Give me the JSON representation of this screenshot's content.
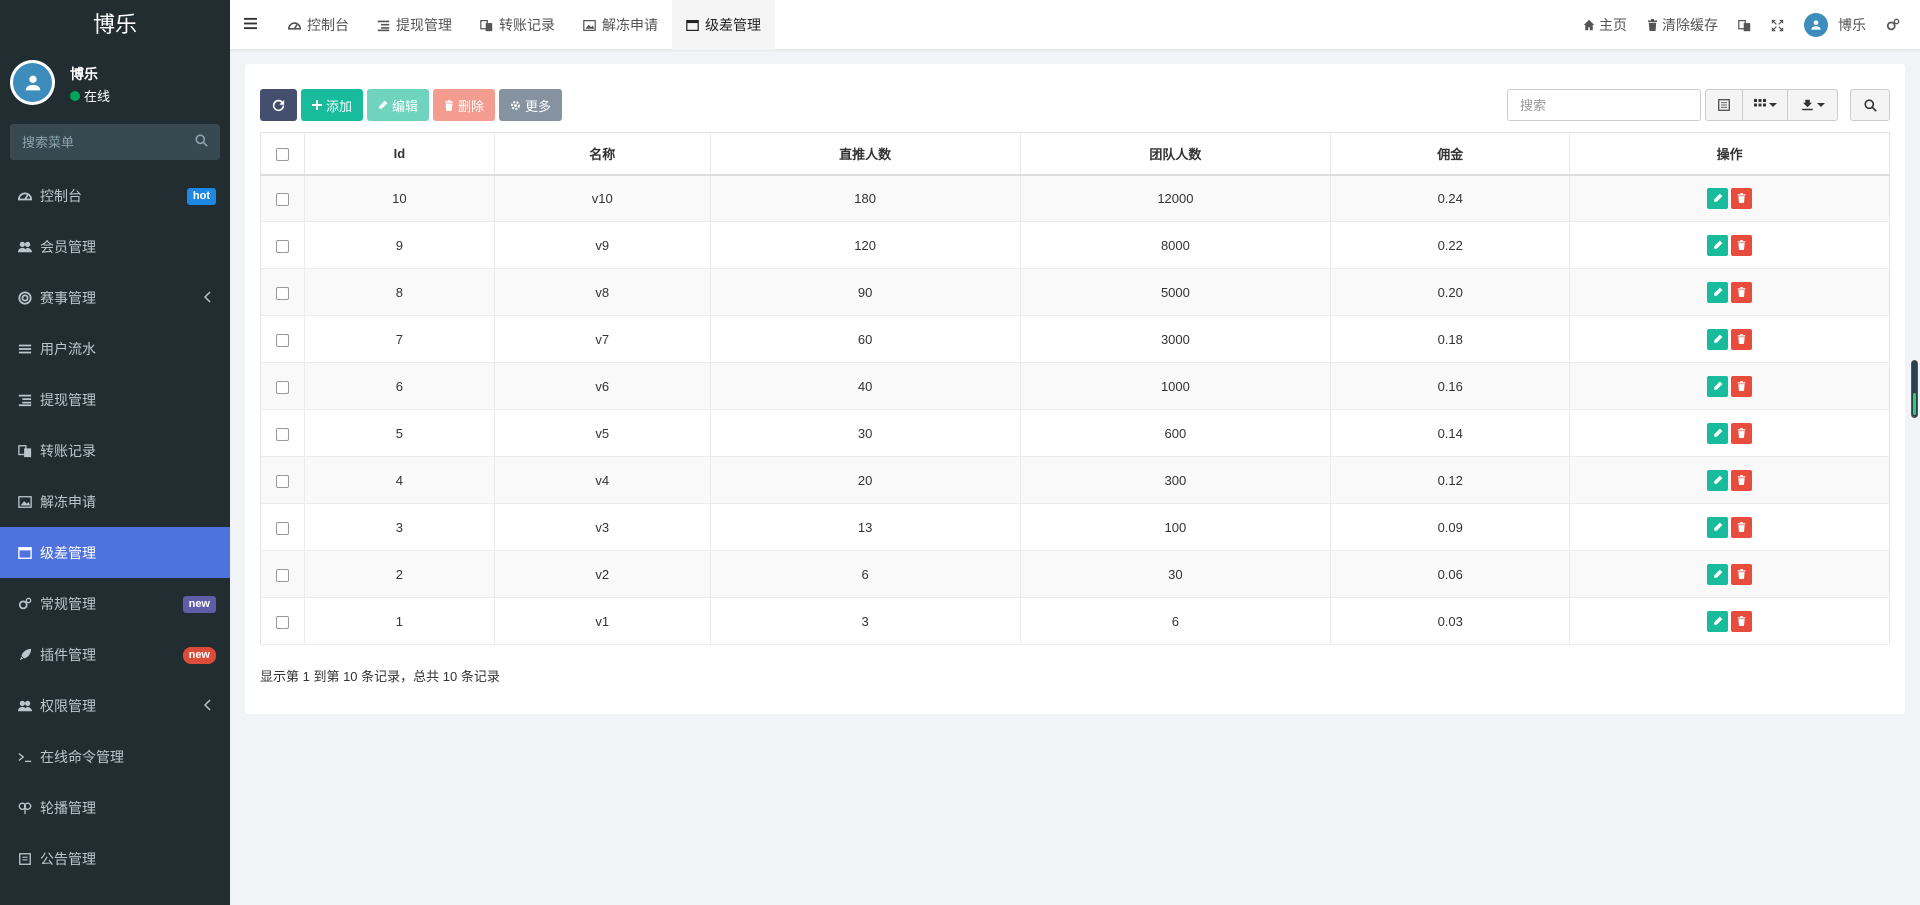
{
  "sidebar": {
    "logo": "博乐",
    "user": {
      "name": "博乐",
      "status": "在线"
    },
    "search_placeholder": "搜索菜单",
    "items": [
      {
        "label": "控制台",
        "badge": "hot"
      },
      {
        "label": "会员管理"
      },
      {
        "label": "赛事管理"
      },
      {
        "label": "用户流水"
      },
      {
        "label": "提现管理"
      },
      {
        "label": "转账记录"
      },
      {
        "label": "解冻申请"
      },
      {
        "label": "级差管理"
      },
      {
        "label": "常规管理",
        "badge": "new"
      },
      {
        "label": "插件管理",
        "badge": "new"
      },
      {
        "label": "权限管理"
      },
      {
        "label": "在线命令管理"
      },
      {
        "label": "轮播管理"
      },
      {
        "label": "公告管理"
      }
    ]
  },
  "navbar": {
    "tabs": [
      "控制台",
      "提现管理",
      "转账记录",
      "解冻申请",
      "级差管理"
    ],
    "home": "主页",
    "clear_cache": "清除缓存",
    "username": "博乐"
  },
  "toolbar": {
    "add": "添加",
    "edit": "编辑",
    "delete": "删除",
    "more": "更多",
    "search_placeholder": "搜索"
  },
  "table": {
    "headers": [
      "Id",
      "名称",
      "直推人数",
      "团队人数",
      "佣金",
      "操作"
    ],
    "rows": [
      [
        "10",
        "v10",
        "180",
        "12000",
        "0.24"
      ],
      [
        "9",
        "v9",
        "120",
        "8000",
        "0.22"
      ],
      [
        "8",
        "v8",
        "90",
        "5000",
        "0.20"
      ],
      [
        "7",
        "v7",
        "60",
        "3000",
        "0.18"
      ],
      [
        "6",
        "v6",
        "40",
        "1000",
        "0.16"
      ],
      [
        "5",
        "v5",
        "30",
        "600",
        "0.14"
      ],
      [
        "4",
        "v4",
        "20",
        "300",
        "0.12"
      ],
      [
        "3",
        "v3",
        "13",
        "100",
        "0.09"
      ],
      [
        "2",
        "v2",
        "6",
        "30",
        "0.06"
      ],
      [
        "1",
        "v1",
        "3",
        "6",
        "0.03"
      ]
    ]
  },
  "pagination_info": "显示第 1 到第 10 条记录，总共 10 条记录",
  "colors": {
    "sidebar_bg": "#222d32",
    "active": "#4e73df",
    "success": "#18bc9c",
    "danger": "#e74c3c"
  }
}
